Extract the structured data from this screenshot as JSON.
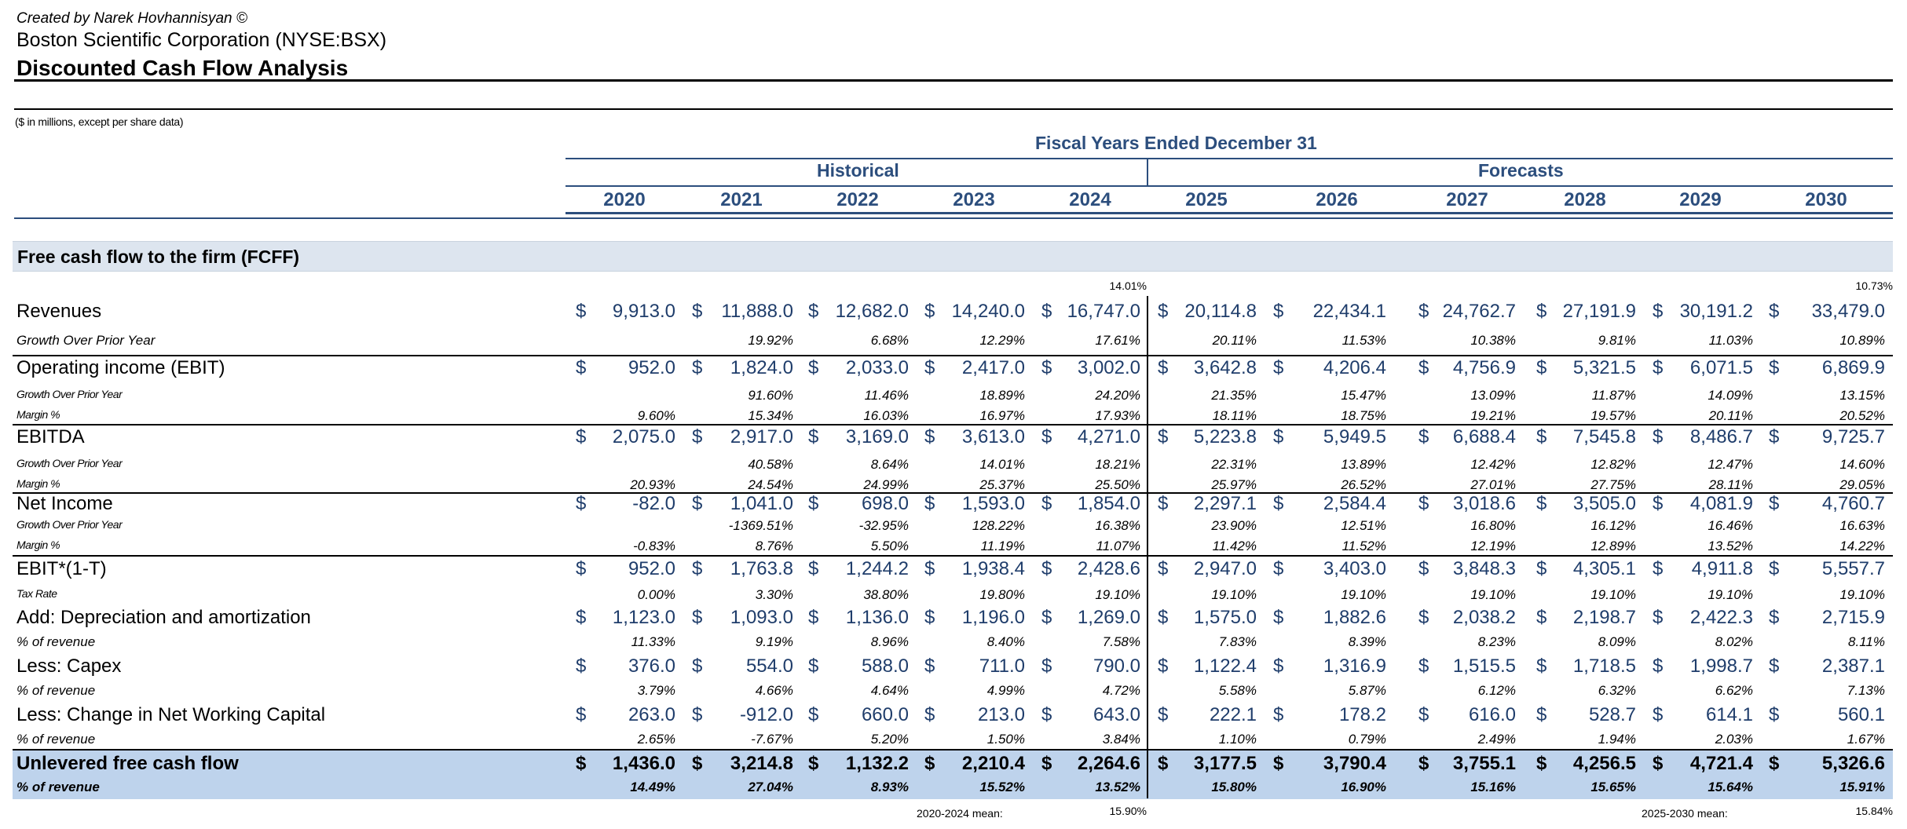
{
  "header": {
    "credit": "Created by Narek Hovhannisyan ©",
    "company": "Boston Scientific Corporation (NYSE:BSX)",
    "title": "Discounted Cash Flow Analysis",
    "units": "($ in millions, except per share data)"
  },
  "columns": {
    "fiscal_label": "Fiscal Years Ended December 31",
    "historical_label": "Historical",
    "forecasts_label": "Forecasts",
    "years": [
      "2020",
      "2021",
      "2022",
      "2023",
      "2024",
      "2025",
      "2026",
      "2027",
      "2028",
      "2029",
      "2030"
    ]
  },
  "section_title": "Free cash flow to the firm (FCFF)",
  "top_notes": {
    "n2024": "14.01%",
    "n2030": "10.73%"
  },
  "rows": {
    "revenues": {
      "label": "Revenues",
      "values": [
        "9,913.0",
        "11,888.0",
        "12,682.0",
        "14,240.0",
        "16,747.0",
        "20,114.8",
        "22,434.1",
        "24,762.7",
        "27,191.9",
        "30,191.2",
        "33,479.0"
      ]
    },
    "rev_growth": {
      "label": "Growth Over Prior Year",
      "values": [
        "",
        "19.92%",
        "6.68%",
        "12.29%",
        "17.61%",
        "20.11%",
        "11.53%",
        "10.38%",
        "9.81%",
        "11.03%",
        "10.89%"
      ]
    },
    "ebit": {
      "label": "Operating income (EBIT)",
      "values": [
        "952.0",
        "1,824.0",
        "2,033.0",
        "2,417.0",
        "3,002.0",
        "3,642.8",
        "4,206.4",
        "4,756.9",
        "5,321.5",
        "6,071.5",
        "6,869.9"
      ]
    },
    "ebit_growth": {
      "label": "Growth Over Prior Year",
      "values": [
        "",
        "91.60%",
        "11.46%",
        "18.89%",
        "24.20%",
        "21.35%",
        "15.47%",
        "13.09%",
        "11.87%",
        "14.09%",
        "13.15%"
      ]
    },
    "ebit_margin": {
      "label": "Margin %",
      "values": [
        "9.60%",
        "15.34%",
        "16.03%",
        "16.97%",
        "17.93%",
        "18.11%",
        "18.75%",
        "19.21%",
        "19.57%",
        "20.11%",
        "20.52%"
      ]
    },
    "ebitda": {
      "label": "EBITDA",
      "values": [
        "2,075.0",
        "2,917.0",
        "3,169.0",
        "3,613.0",
        "4,271.0",
        "5,223.8",
        "5,949.5",
        "6,688.4",
        "7,545.8",
        "8,486.7",
        "9,725.7"
      ]
    },
    "ebitda_growth": {
      "label": "Growth Over Prior Year",
      "values": [
        "",
        "40.58%",
        "8.64%",
        "14.01%",
        "18.21%",
        "22.31%",
        "13.89%",
        "12.42%",
        "12.82%",
        "12.47%",
        "14.60%"
      ]
    },
    "ebitda_margin": {
      "label": "Margin %",
      "values": [
        "20.93%",
        "24.54%",
        "24.99%",
        "25.37%",
        "25.50%",
        "25.97%",
        "26.52%",
        "27.01%",
        "27.75%",
        "28.11%",
        "29.05%"
      ]
    },
    "ni": {
      "label": "Net Income",
      "values": [
        "-82.0",
        "1,041.0",
        "698.0",
        "1,593.0",
        "1,854.0",
        "2,297.1",
        "2,584.4",
        "3,018.6",
        "3,505.0",
        "4,081.9",
        "4,760.7"
      ]
    },
    "ni_growth": {
      "label": "Growth Over Prior Year",
      "values": [
        "",
        "-1369.51%",
        "-32.95%",
        "128.22%",
        "16.38%",
        "23.90%",
        "12.51%",
        "16.80%",
        "16.12%",
        "16.46%",
        "16.63%"
      ]
    },
    "ni_margin": {
      "label": "Margin %",
      "values": [
        "-0.83%",
        "8.76%",
        "5.50%",
        "11.19%",
        "11.07%",
        "11.42%",
        "11.52%",
        "12.19%",
        "12.89%",
        "13.52%",
        "14.22%"
      ]
    },
    "nopat": {
      "label": "EBIT*(1-T)",
      "values": [
        "952.0",
        "1,763.8",
        "1,244.2",
        "1,938.4",
        "2,428.6",
        "2,947.0",
        "3,403.0",
        "3,848.3",
        "4,305.1",
        "4,911.8",
        "5,557.7"
      ]
    },
    "tax": {
      "label": "Tax Rate",
      "values": [
        "0.00%",
        "3.30%",
        "38.80%",
        "19.80%",
        "19.10%",
        "19.10%",
        "19.10%",
        "19.10%",
        "19.10%",
        "19.10%",
        "19.10%"
      ]
    },
    "da": {
      "label": "Add: Depreciation and amortization",
      "values": [
        "1,123.0",
        "1,093.0",
        "1,136.0",
        "1,196.0",
        "1,269.0",
        "1,575.0",
        "1,882.6",
        "2,038.2",
        "2,198.7",
        "2,422.3",
        "2,715.9"
      ]
    },
    "da_pct": {
      "label": "% of revenue",
      "values": [
        "11.33%",
        "9.19%",
        "8.96%",
        "8.40%",
        "7.58%",
        "7.83%",
        "8.39%",
        "8.23%",
        "8.09%",
        "8.02%",
        "8.11%"
      ]
    },
    "capex": {
      "label": "Less: Capex",
      "values": [
        "376.0",
        "554.0",
        "588.0",
        "711.0",
        "790.0",
        "1,122.4",
        "1,316.9",
        "1,515.5",
        "1,718.5",
        "1,998.7",
        "2,387.1"
      ]
    },
    "capex_pct": {
      "label": "% of revenue",
      "values": [
        "3.79%",
        "4.66%",
        "4.64%",
        "4.99%",
        "4.72%",
        "5.58%",
        "5.87%",
        "6.12%",
        "6.32%",
        "6.62%",
        "7.13%"
      ]
    },
    "nwc": {
      "label": "Less: Change in Net Working Capital",
      "values": [
        "263.0",
        "-912.0",
        "660.0",
        "213.0",
        "643.0",
        "222.1",
        "178.2",
        "616.0",
        "528.7",
        "614.1",
        "560.1"
      ]
    },
    "nwc_pct": {
      "label": "% of revenue",
      "values": [
        "2.65%",
        "-7.67%",
        "5.20%",
        "1.50%",
        "3.84%",
        "1.10%",
        "0.79%",
        "2.49%",
        "1.94%",
        "2.03%",
        "1.67%"
      ]
    },
    "fcf": {
      "label": "Unlevered free cash flow",
      "values": [
        "1,436.0",
        "3,214.8",
        "1,132.2",
        "2,210.4",
        "2,264.6",
        "3,177.5",
        "3,790.4",
        "3,755.1",
        "4,256.5",
        "4,721.4",
        "5,326.6"
      ]
    },
    "fcf_pct": {
      "label": "% of revenue",
      "values": [
        "14.49%",
        "27.04%",
        "8.93%",
        "15.52%",
        "13.52%",
        "15.80%",
        "16.90%",
        "15.16%",
        "15.65%",
        "15.64%",
        "15.91%"
      ]
    }
  },
  "means": {
    "hist_label": "2020-2024 mean:",
    "hist_value": "15.90%",
    "fcst_label": "2025-2030 mean:",
    "fcst_value": "15.84%"
  },
  "dollar_sign": "$"
}
